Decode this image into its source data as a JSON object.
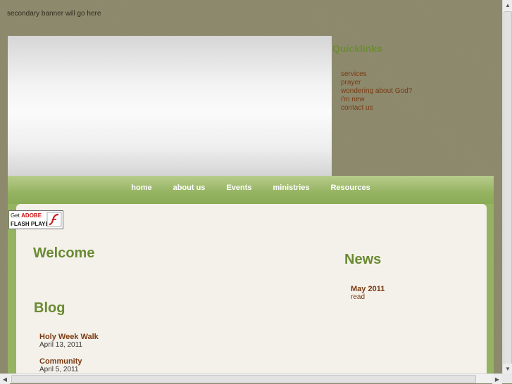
{
  "header": {
    "secondary_banner": "secondary banner will go here"
  },
  "quicklinks": {
    "title": "Quicklinks",
    "items": [
      {
        "label": "services"
      },
      {
        "label": "prayer"
      },
      {
        "label": "wondering about God?"
      },
      {
        "label": "i'm new"
      },
      {
        "label": "contact us"
      }
    ]
  },
  "nav": {
    "items": [
      {
        "label": "home"
      },
      {
        "label": "about us"
      },
      {
        "label": "Events"
      },
      {
        "label": "ministries"
      },
      {
        "label": "Resources"
      }
    ]
  },
  "flash_badge": {
    "get": "Get",
    "adobe": "ADOBE",
    "product": "FLASH PLAYER",
    "icon": "flash-logo-icon"
  },
  "welcome": {
    "heading": "Welcome"
  },
  "blog": {
    "heading": "Blog",
    "posts": [
      {
        "title": "Holy Week Walk",
        "date": "April 13, 2011"
      },
      {
        "title": "Community",
        "date": "April 5, 2011"
      }
    ]
  },
  "news": {
    "heading": "News",
    "items": [
      {
        "title": "May 2011",
        "link": "read"
      }
    ]
  },
  "colors": {
    "page_bg": "#8e8a6e",
    "accent_green": "#6a8a32",
    "link_brown": "#7a3a10",
    "nav_green": "#95b361"
  }
}
